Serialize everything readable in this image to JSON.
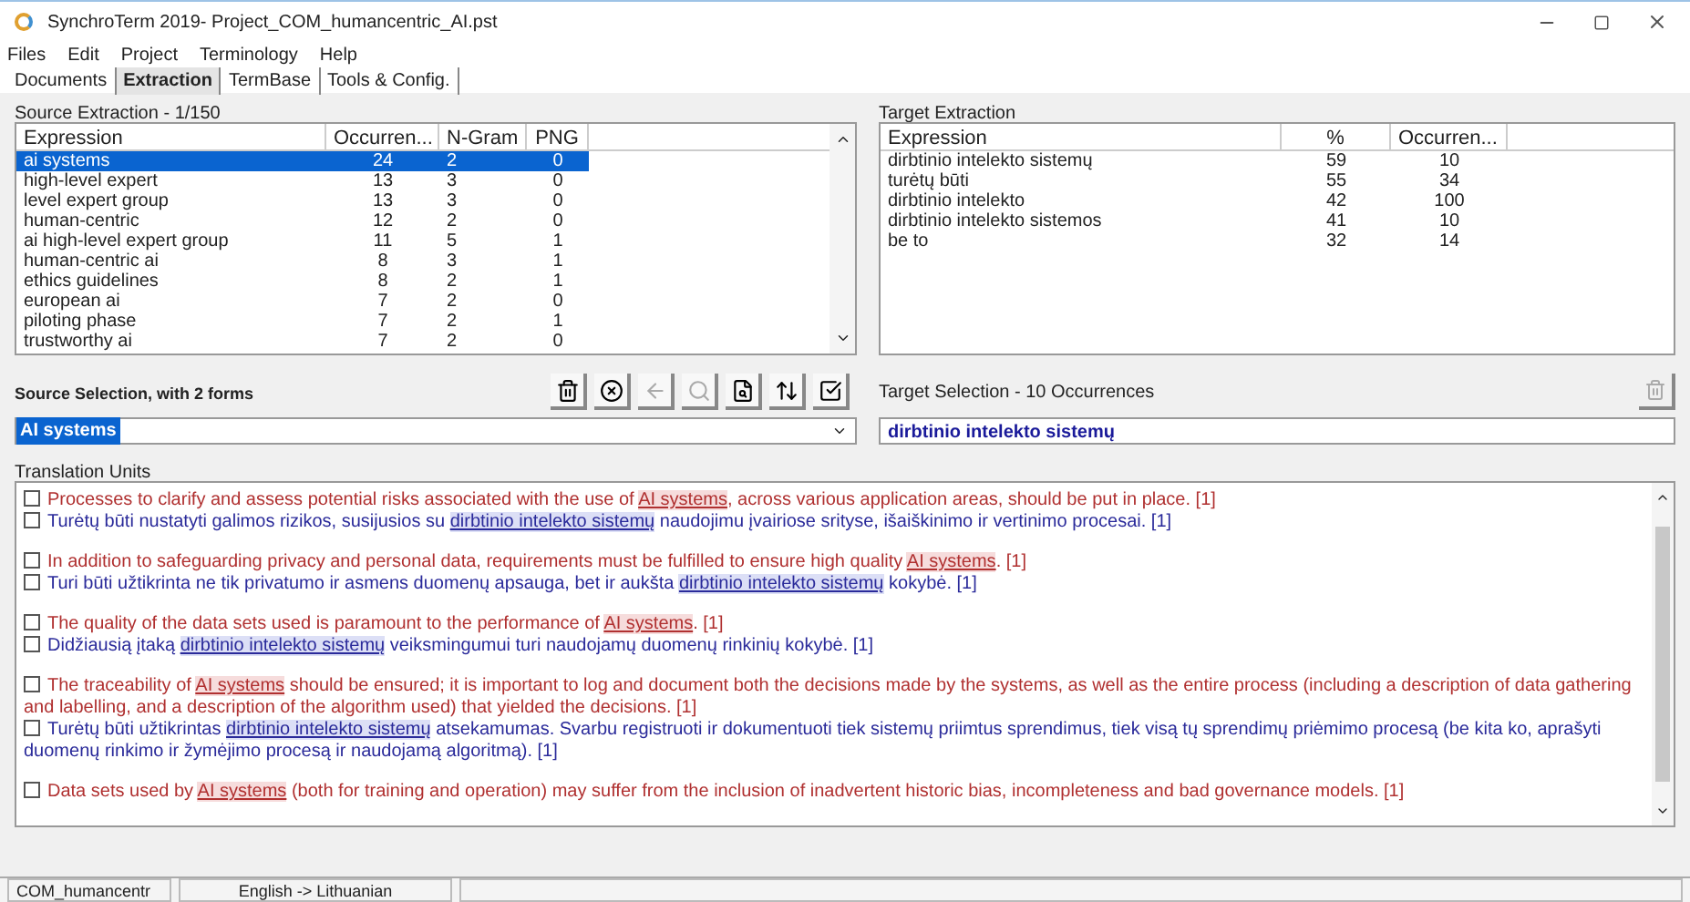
{
  "window": {
    "title": "SynchroTerm 2019- Project_COM_humancentric_AI.pst"
  },
  "menu": [
    "Files",
    "Edit",
    "Project",
    "Terminology",
    "Help"
  ],
  "tabs": [
    {
      "label": "Documents",
      "selected": false
    },
    {
      "label": "Extraction",
      "selected": true
    },
    {
      "label": "TermBase",
      "selected": false
    },
    {
      "label": "Tools & Config.",
      "selected": false
    }
  ],
  "source_extraction": {
    "title": "Source Extraction - 1/150",
    "columns": [
      "Expression",
      "Occurren...",
      "N-Gram",
      "PNG"
    ],
    "rows": [
      {
        "cells": [
          "ai systems",
          "24",
          "2",
          "0"
        ],
        "selected": true
      },
      {
        "cells": [
          "high-level expert",
          "13",
          "3",
          "0"
        ],
        "selected": false
      },
      {
        "cells": [
          "level expert group",
          "13",
          "3",
          "0"
        ],
        "selected": false
      },
      {
        "cells": [
          "human-centric",
          "12",
          "2",
          "0"
        ],
        "selected": false
      },
      {
        "cells": [
          "ai high-level expert group",
          "11",
          "5",
          "1"
        ],
        "selected": false
      },
      {
        "cells": [
          "human-centric ai",
          "8",
          "3",
          "1"
        ],
        "selected": false
      },
      {
        "cells": [
          "ethics guidelines",
          "8",
          "2",
          "1"
        ],
        "selected": false
      },
      {
        "cells": [
          "european ai",
          "7",
          "2",
          "0"
        ],
        "selected": false
      },
      {
        "cells": [
          "piloting phase",
          "7",
          "2",
          "1"
        ],
        "selected": false
      },
      {
        "cells": [
          "trustworthy ai",
          "7",
          "2",
          "0"
        ],
        "selected": false
      }
    ]
  },
  "target_extraction": {
    "title": "Target Extraction",
    "columns": [
      "Expression",
      "%",
      "Occurren..."
    ],
    "rows": [
      {
        "cells": [
          "dirbtinio intelekto sistemų",
          "59",
          "10"
        ]
      },
      {
        "cells": [
          "turėtų būti",
          "55",
          "34"
        ]
      },
      {
        "cells": [
          "dirbtinio intelekto",
          "42",
          "100"
        ]
      },
      {
        "cells": [
          "dirbtinio intelekto sistemos",
          "41",
          "10"
        ]
      },
      {
        "cells": [
          "be to",
          "32",
          "14"
        ]
      }
    ]
  },
  "toolbar": [
    {
      "kind": "delete",
      "disabled": false
    },
    {
      "kind": "cancel",
      "disabled": false
    },
    {
      "kind": "back",
      "disabled": true
    },
    {
      "kind": "search",
      "disabled": true
    },
    {
      "kind": "find",
      "disabled": false
    },
    {
      "kind": "sort",
      "disabled": false
    },
    {
      "kind": "validate",
      "disabled": false
    }
  ],
  "source_selection": {
    "label": "Source Selection, with 2 forms",
    "value": "AI systems"
  },
  "target_selection": {
    "label": "Target Selection - 10 Occurrences",
    "value": "dirbtinio intelekto sistemų"
  },
  "translation_units": {
    "title": "Translation Units",
    "units": [
      {
        "source_checked": false,
        "target_checked": false,
        "source": [
          {
            "text": "Processes to clarify and assess potential risks associated with the use of ",
            "term": false
          },
          {
            "text": "AI systems",
            "term": true
          },
          {
            "text": ", across various application areas, should be put in place. [1]",
            "term": false
          }
        ],
        "target": [
          {
            "text": "Turėtų būti nustatyti galimos rizikos, susijusios su ",
            "term": false
          },
          {
            "text": "dirbtinio intelekto sistemų",
            "term": true
          },
          {
            "text": " naudojimu įvairiose srityse, išaiškinimo ir vertinimo procesai. [1]",
            "term": false
          }
        ]
      },
      {
        "source_checked": false,
        "target_checked": false,
        "source": [
          {
            "text": "In addition to safeguarding privacy and personal data, requirements must be fulfilled to ensure high quality ",
            "term": false
          },
          {
            "text": "AI systems",
            "term": true
          },
          {
            "text": ". [1]",
            "term": false
          }
        ],
        "target": [
          {
            "text": "Turi būti užtikrinta ne tik privatumo ir asmens duomenų apsauga, bet ir aukšta ",
            "term": false
          },
          {
            "text": "dirbtinio intelekto sistemų",
            "term": true
          },
          {
            "text": " kokybė. [1]",
            "term": false
          }
        ]
      },
      {
        "source_checked": false,
        "target_checked": false,
        "source": [
          {
            "text": "The quality of the data sets used is paramount to the performance of ",
            "term": false
          },
          {
            "text": "AI systems",
            "term": true
          },
          {
            "text": ". [1]",
            "term": false
          }
        ],
        "target": [
          {
            "text": "Didžiausią įtaką ",
            "term": false
          },
          {
            "text": "dirbtinio intelekto sistemų",
            "term": true
          },
          {
            "text": " veiksmingumui turi naudojamų duomenų rinkinių kokybė. [1]",
            "term": false
          }
        ]
      },
      {
        "source_checked": false,
        "target_checked": false,
        "source": [
          {
            "text": "The traceability of ",
            "term": false
          },
          {
            "text": "AI systems",
            "term": true
          },
          {
            "text": " should be ensured; it is important to log and document both the decisions made by the systems, as well as the entire process (including a description of data gathering and labelling, and a description of the algorithm used) that yielded the decisions. [1]",
            "term": false
          }
        ],
        "target": [
          {
            "text": "Turėtų būti užtikrintas ",
            "term": false
          },
          {
            "text": "dirbtinio intelekto sistemų",
            "term": true
          },
          {
            "text": " atsekamumas. Svarbu registruoti ir dokumentuoti tiek sistemų priimtus sprendimus, tiek visą tų sprendimų priėmimo procesą (be kita ko, aprašyti duomenų rinkimo ir žymėjimo procesą ir naudojamą algoritmą). [1]",
            "term": false
          }
        ]
      },
      {
        "source_checked": false,
        "source": [
          {
            "text": "Data sets used by ",
            "term": false
          },
          {
            "text": "AI systems",
            "term": true
          },
          {
            "text": " (both for training and operation) may suffer from the inclusion of inadvertent historic bias, incompleteness and bad governance models. [1]",
            "term": false
          }
        ]
      }
    ]
  },
  "status_bar": [
    "COM_humancentr",
    "English -> Lithuanian"
  ]
}
